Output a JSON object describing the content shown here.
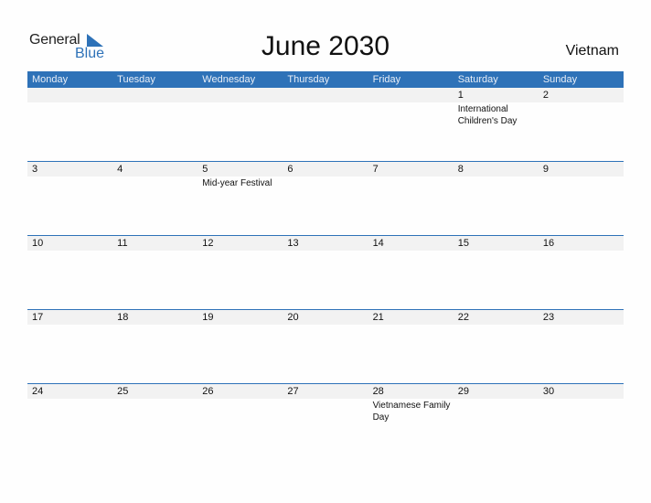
{
  "logo": {
    "text_general": "General",
    "text_blue": "Blue"
  },
  "title": "June 2030",
  "country": "Vietnam",
  "colors": {
    "accent": "#2e72b8",
    "day_row_bg": "#f2f2f2"
  },
  "weekdays": [
    "Monday",
    "Tuesday",
    "Wednesday",
    "Thursday",
    "Friday",
    "Saturday",
    "Sunday"
  ],
  "weeks": [
    {
      "days": [
        "",
        "",
        "",
        "",
        "",
        "1",
        "2"
      ],
      "events": [
        "",
        "",
        "",
        "",
        "",
        "International Children's Day",
        ""
      ]
    },
    {
      "days": [
        "3",
        "4",
        "5",
        "6",
        "7",
        "8",
        "9"
      ],
      "events": [
        "",
        "",
        "Mid-year Festival",
        "",
        "",
        "",
        ""
      ]
    },
    {
      "days": [
        "10",
        "11",
        "12",
        "13",
        "14",
        "15",
        "16"
      ],
      "events": [
        "",
        "",
        "",
        "",
        "",
        "",
        ""
      ]
    },
    {
      "days": [
        "17",
        "18",
        "19",
        "20",
        "21",
        "22",
        "23"
      ],
      "events": [
        "",
        "",
        "",
        "",
        "",
        "",
        ""
      ]
    },
    {
      "days": [
        "24",
        "25",
        "26",
        "27",
        "28",
        "29",
        "30"
      ],
      "events": [
        "",
        "",
        "",
        "",
        "Vietnamese Family Day",
        "",
        ""
      ]
    }
  ]
}
